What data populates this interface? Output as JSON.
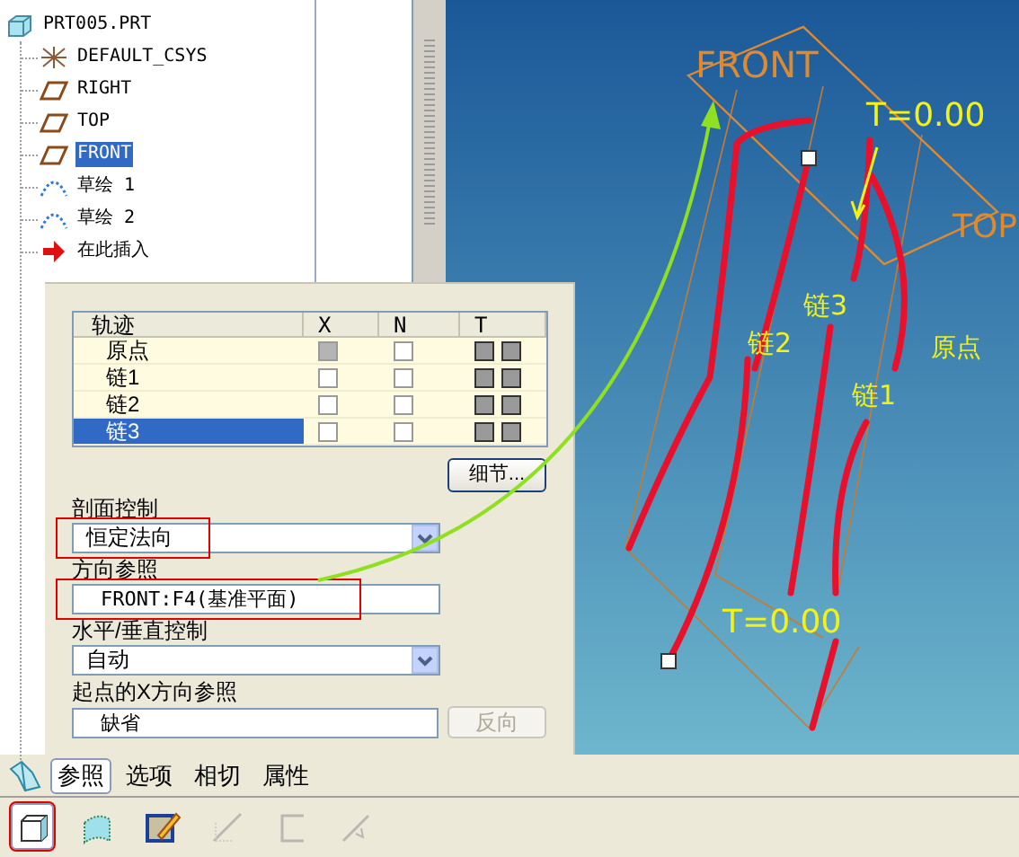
{
  "model_tree": {
    "items": [
      {
        "label": "PRT005.PRT",
        "kind": "part",
        "selected": false,
        "children": [
          {
            "label": "DEFAULT_CSYS",
            "kind": "csys",
            "selected": false
          },
          {
            "label": "RIGHT",
            "kind": "plane",
            "selected": false
          },
          {
            "label": "TOP",
            "kind": "plane",
            "selected": false
          },
          {
            "label": "FRONT",
            "kind": "plane",
            "selected": true
          },
          {
            "label": "草绘 1",
            "kind": "sketch",
            "selected": false
          },
          {
            "label": "草绘 2",
            "kind": "sketch",
            "selected": false
          },
          {
            "label": "在此插入",
            "kind": "insert",
            "selected": false
          }
        ]
      }
    ]
  },
  "trajectory_table": {
    "columns": [
      "轨迹",
      "X",
      "N",
      "T"
    ],
    "rows": [
      {
        "name": "原点",
        "x_checked": true,
        "n_checked": false,
        "selected": false
      },
      {
        "name": "链1",
        "x_checked": false,
        "n_checked": false,
        "selected": false
      },
      {
        "name": "链2",
        "x_checked": false,
        "n_checked": false,
        "selected": false
      },
      {
        "name": "链3",
        "x_checked": false,
        "n_checked": false,
        "selected": true
      }
    ]
  },
  "details_button": "细节...",
  "fields": [
    {
      "label": "剖面控制",
      "kind": "dropdown",
      "value": "恒定法向",
      "highlighted": true
    },
    {
      "label": "方向参照",
      "kind": "text",
      "value": "FRONT:F4(基准平面)",
      "highlighted": true
    },
    {
      "label": "水平/垂直控制",
      "kind": "dropdown",
      "value": "自动",
      "highlighted": false
    },
    {
      "label": "起点的X方向参照",
      "kind": "text",
      "value": "缺省",
      "highlighted": false,
      "button": {
        "label": "反向",
        "disabled": true
      }
    }
  ],
  "tabs": [
    {
      "label": "参照",
      "selected": true
    },
    {
      "label": "选项",
      "selected": false
    },
    {
      "label": "相切",
      "selected": false
    },
    {
      "label": "属性",
      "selected": false
    }
  ],
  "toolbar": [
    {
      "kind": "solid",
      "selected": true,
      "disabled": false
    },
    {
      "kind": "surface",
      "selected": false,
      "disabled": false
    },
    {
      "kind": "sketch",
      "selected": false,
      "disabled": false
    },
    {
      "kind": "cut",
      "selected": false,
      "disabled": true
    },
    {
      "kind": "thicken",
      "selected": false,
      "disabled": true
    },
    {
      "kind": "arrow",
      "selected": false,
      "disabled": true
    }
  ],
  "viewport": {
    "labels": [
      {
        "text": "FRONT",
        "kind": "datum"
      },
      {
        "text": "T=0.00",
        "kind": "parameter"
      },
      {
        "text": "TOP",
        "kind": "datum"
      },
      {
        "text": "链3",
        "kind": "chain"
      },
      {
        "text": "链2",
        "kind": "chain"
      },
      {
        "text": "原点",
        "kind": "chain"
      },
      {
        "text": "链1",
        "kind": "chain"
      },
      {
        "text": "T=0.00",
        "kind": "parameter"
      }
    ]
  }
}
